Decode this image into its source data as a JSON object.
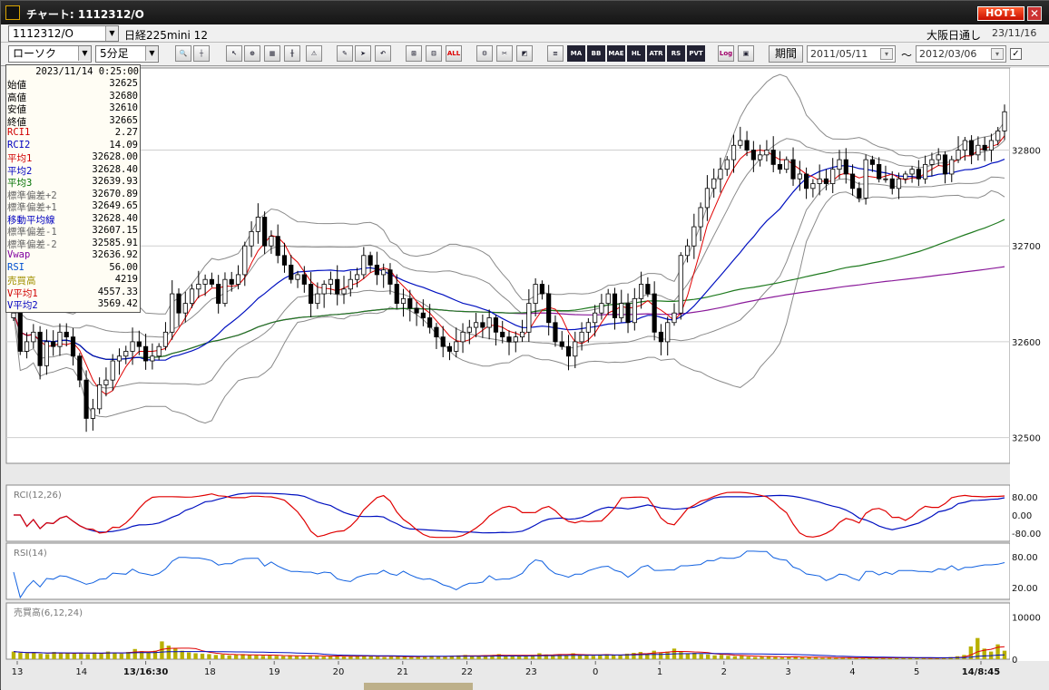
{
  "window": {
    "title": "チャート: 1112312/O",
    "hot_label": "HOT1",
    "close_glyph": "✕"
  },
  "header": {
    "code_value": "1112312/O",
    "instrument_name": "日経225mini 12",
    "exchange": "大阪日通し",
    "date": "23/11/16"
  },
  "toolbar": {
    "chart_type": "ローソク",
    "interval": "5分足",
    "period_label": "期間",
    "start_date": "2011/05/11",
    "tilde": "〜",
    "end_date": "2012/03/06",
    "buttons": [
      "MA",
      "BB",
      "MAE",
      "HL",
      "ATR",
      "RS",
      "PVT",
      "Log"
    ]
  },
  "info": {
    "datetime": "2023/11/14 0:25:00",
    "rows": [
      {
        "label": "始値",
        "value": "32625",
        "color": "#000000"
      },
      {
        "label": "高値",
        "value": "32680",
        "color": "#000000"
      },
      {
        "label": "安値",
        "value": "32610",
        "color": "#000000"
      },
      {
        "label": "終値",
        "value": "32665",
        "color": "#000000"
      },
      {
        "label": "RCI1",
        "value": "2.27",
        "color": "#d00000"
      },
      {
        "label": "RCI2",
        "value": "14.09",
        "color": "#0000c0"
      },
      {
        "label": "平均1",
        "value": "32628.00",
        "color": "#d00000"
      },
      {
        "label": "平均2",
        "value": "32628.40",
        "color": "#0000c0"
      },
      {
        "label": "平均3",
        "value": "32639.93",
        "color": "#007000"
      },
      {
        "label": "標準偏差+2",
        "value": "32670.89",
        "color": "#666666"
      },
      {
        "label": "標準偏差+1",
        "value": "32649.65",
        "color": "#666666"
      },
      {
        "label": "移動平均線",
        "value": "32628.40",
        "color": "#0000c0"
      },
      {
        "label": "標準偏差-1",
        "value": "32607.15",
        "color": "#666666"
      },
      {
        "label": "標準偏差-2",
        "value": "32585.91",
        "color": "#666666"
      },
      {
        "label": "Vwap",
        "value": "32636.92",
        "color": "#8000a0"
      },
      {
        "label": "RSI",
        "value": "56.00",
        "color": "#0050d0"
      },
      {
        "label": "売買高",
        "value": "4219",
        "color": "#a09000"
      },
      {
        "label": "V平均1",
        "value": "4557.33",
        "color": "#d00000"
      },
      {
        "label": "V平均2",
        "value": "3569.42",
        "color": "#0000c0"
      }
    ]
  },
  "panels": {
    "rci_label": "RCI(12,26)",
    "rsi_label": "RSI(14)",
    "vol_label": "売買高(6,12,24)"
  },
  "colors": {
    "up": "#ffffff",
    "down": "#000000",
    "ma1": "#e00000",
    "ma2": "#0010c0",
    "ma3": "#1f7a1f",
    "bands": "#8a8a8a",
    "vwap": "#8a1a9a",
    "rsi": "#1060e0",
    "volume": "#b8b000"
  },
  "chart_data": [
    {
      "type": "candlestick",
      "title": "",
      "y_ticks": [
        "32800",
        "32700",
        "32600",
        "32500"
      ],
      "ylim": [
        32475,
        32880
      ],
      "x_ticks": [
        "13",
        "14",
        "13/16:30",
        "18",
        "19",
        "20",
        "21",
        "22",
        "23",
        "0",
        "1",
        "2",
        "3",
        "4",
        "5",
        "14/8:45"
      ],
      "close": [
        32630,
        32590,
        32600,
        32610,
        32575,
        32600,
        32595,
        32610,
        32605,
        32585,
        32560,
        32520,
        32530,
        32555,
        32560,
        32580,
        32585,
        32590,
        32600,
        32595,
        32580,
        32585,
        32595,
        32610,
        32650,
        32630,
        32640,
        32655,
        32660,
        32665,
        32660,
        32640,
        32665,
        32660,
        32670,
        32700,
        32715,
        32730,
        32700,
        32710,
        32690,
        32680,
        32665,
        32670,
        32660,
        32640,
        32650,
        32660,
        32665,
        32650,
        32655,
        32665,
        32670,
        32690,
        32680,
        32670,
        32675,
        32660,
        32640,
        32645,
        32635,
        32630,
        32625,
        32615,
        32605,
        32595,
        32590,
        32600,
        32610,
        32615,
        32620,
        32615,
        32625,
        32610,
        32605,
        32600,
        32605,
        32610,
        32640,
        32660,
        32650,
        32620,
        32600,
        32595,
        32585,
        32600,
        32610,
        32620,
        32630,
        32640,
        32650,
        32625,
        32640,
        32620,
        32645,
        32660,
        32650,
        32610,
        32600,
        32620,
        32630,
        32690,
        32700,
        32720,
        32740,
        32760,
        32770,
        32780,
        32790,
        32805,
        32810,
        32800,
        32790,
        32795,
        32800,
        32785,
        32780,
        32790,
        32770,
        32775,
        32760,
        32765,
        32770,
        32765,
        32780,
        32790,
        32775,
        32760,
        32750,
        32790,
        32785,
        32770,
        32770,
        32760,
        32770,
        32775,
        32780,
        32770,
        32785,
        32790,
        32795,
        32775,
        32790,
        32800,
        32810,
        32795,
        32805,
        32800,
        32810,
        32820,
        32840
      ]
    },
    {
      "type": "line",
      "name": "RCI(12,26)",
      "y_ticks": [
        "80.00",
        "0.00",
        "-80.00"
      ],
      "ylim": [
        -100,
        100
      ]
    },
    {
      "type": "line",
      "name": "RSI(14)",
      "y_ticks": [
        "80.00",
        "20.00"
      ],
      "ylim": [
        0,
        100
      ]
    },
    {
      "type": "bar",
      "name": "売買高(6,12,24)",
      "y_ticks": [
        "10000",
        "0"
      ],
      "ylim": [
        0,
        12000
      ],
      "values": [
        1800,
        1500,
        1400,
        1600,
        1300,
        1200,
        1700,
        1500,
        1400,
        1300,
        1500,
        1200,
        1600,
        1400,
        1800,
        1500,
        1300,
        1700,
        2400,
        1900,
        1600,
        2000,
        4200,
        3200,
        2500,
        2000,
        1600,
        1400,
        1300,
        1200,
        1000,
        1100,
        900,
        1000,
        1200,
        1000,
        900,
        800,
        900,
        800,
        700,
        900,
        700,
        800,
        900,
        700,
        600,
        700,
        800,
        600,
        700,
        800,
        900,
        700,
        600,
        500,
        600,
        700,
        600,
        500,
        600,
        700,
        800,
        600,
        700,
        800,
        900,
        1000,
        800,
        700,
        900,
        1000,
        1200,
        900,
        800,
        700,
        900,
        1000,
        1400,
        1100,
        900,
        1200,
        900,
        1400,
        1000,
        900,
        800,
        1100,
        1200,
        1000,
        900,
        1300,
        1500,
        1700,
        1400,
        2000,
        1500,
        1800,
        2500,
        1700,
        1300,
        1500,
        1200,
        1100,
        900,
        1000,
        800,
        700,
        800,
        600,
        500,
        600,
        700,
        500,
        400,
        500,
        600,
        400,
        500,
        400,
        300,
        400,
        300,
        400,
        350,
        300,
        250,
        300,
        350,
        300,
        400,
        300,
        250,
        350,
        300,
        250,
        200,
        300,
        400,
        500,
        700,
        1000,
        3000,
        5000,
        2500,
        1800,
        3500,
        2000
      ]
    }
  ]
}
